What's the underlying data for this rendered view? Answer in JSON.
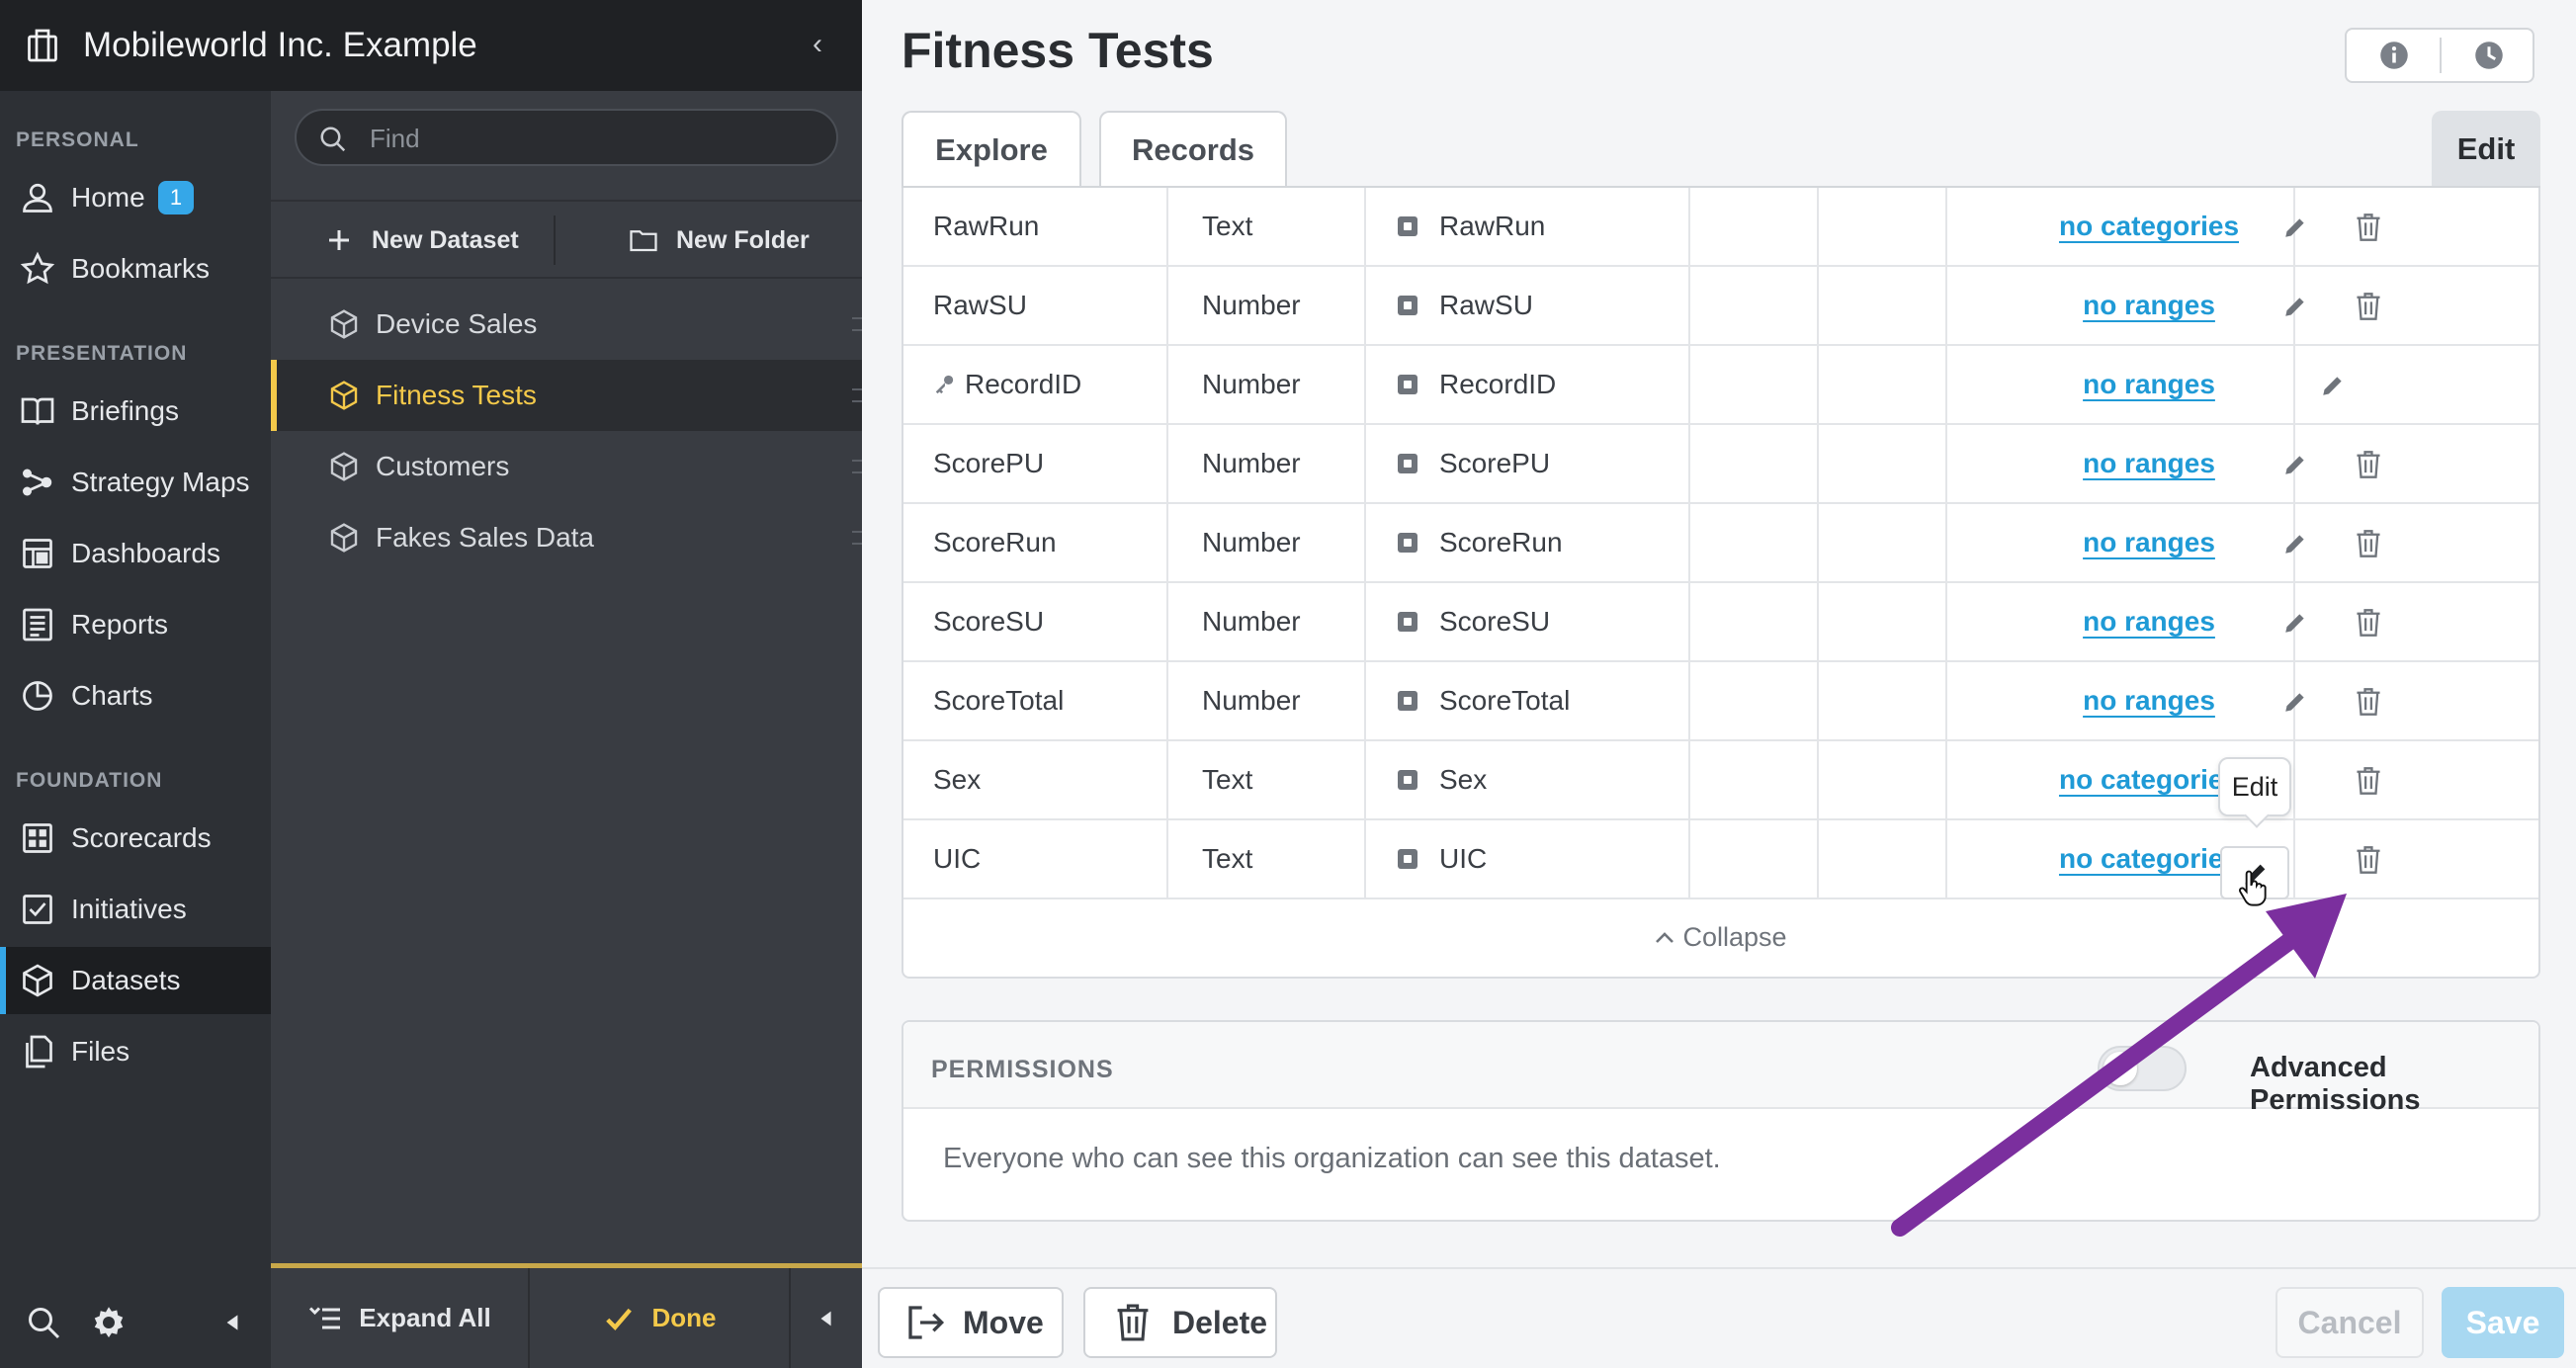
{
  "org": {
    "name": "Mobileworld Inc. Example",
    "icon": "building-icon",
    "collapse_icon": "chevron-left-icon"
  },
  "nav": {
    "sections": {
      "personal": "PERSONAL",
      "presentation": "PRESENTATION",
      "foundation": "FOUNDATION"
    },
    "items": [
      {
        "label": "Home",
        "icon": "person-icon",
        "badge": "1"
      },
      {
        "label": "Bookmarks",
        "icon": "star-icon"
      },
      {
        "label": "Briefings",
        "icon": "book-icon"
      },
      {
        "label": "Strategy Maps",
        "icon": "strategy-map-icon"
      },
      {
        "label": "Dashboards",
        "icon": "dashboard-icon"
      },
      {
        "label": "Reports",
        "icon": "report-icon"
      },
      {
        "label": "Charts",
        "icon": "pie-chart-icon"
      },
      {
        "label": "Scorecards",
        "icon": "scorecard-icon"
      },
      {
        "label": "Initiatives",
        "icon": "checkbox-icon"
      },
      {
        "label": "Datasets",
        "icon": "cube-icon",
        "active": true
      },
      {
        "label": "Files",
        "icon": "files-icon"
      }
    ]
  },
  "tree": {
    "search_placeholder": "Find",
    "new_dataset": "New Dataset",
    "new_folder": "New Folder",
    "datasets": [
      {
        "label": "Device Sales"
      },
      {
        "label": "Fitness Tests",
        "active": true
      },
      {
        "label": "Customers"
      },
      {
        "label": "Fakes Sales Data"
      }
    ],
    "expand_all": "Expand All",
    "done": "Done"
  },
  "main": {
    "title": "Fitness Tests",
    "tabs": {
      "explore": "Explore",
      "records": "Records",
      "edit": "Edit"
    },
    "fields": [
      {
        "name": "RawRun",
        "type": "Text",
        "column": "RawRun",
        "mapping": "no categories",
        "deletable": true
      },
      {
        "name": "RawSU",
        "type": "Number",
        "column": "RawSU",
        "mapping": "no ranges",
        "deletable": true
      },
      {
        "name": "RecordID",
        "type": "Number",
        "column": "RecordID",
        "mapping": "no ranges",
        "key": true,
        "deletable": false
      },
      {
        "name": "ScorePU",
        "type": "Number",
        "column": "ScorePU",
        "mapping": "no ranges",
        "deletable": true
      },
      {
        "name": "ScoreRun",
        "type": "Number",
        "column": "ScoreRun",
        "mapping": "no ranges",
        "deletable": true
      },
      {
        "name": "ScoreSU",
        "type": "Number",
        "column": "ScoreSU",
        "mapping": "no ranges",
        "deletable": true
      },
      {
        "name": "ScoreTotal",
        "type": "Number",
        "column": "ScoreTotal",
        "mapping": "no ranges",
        "deletable": true
      },
      {
        "name": "Sex",
        "type": "Text",
        "column": "Sex",
        "mapping": "no categories",
        "deletable": true
      },
      {
        "name": "UIC",
        "type": "Text",
        "column": "UIC",
        "mapping": "no categories",
        "deletable": true
      }
    ],
    "collapse": "Collapse",
    "tooltip": "Edit",
    "permissions": {
      "title": "PERMISSIONS",
      "advanced_label": "Advanced Permissions",
      "advanced_enabled": false,
      "description": "Everyone who can see this organization can see this dataset."
    },
    "buttons": {
      "move": "Move",
      "delete": "Delete",
      "cancel": "Cancel",
      "save": "Save"
    }
  },
  "colors": {
    "accent": "#35a7e8",
    "active_dataset": "#f4c94a",
    "link": "#1f9ad6",
    "annotation_arrow": "#7b2f9e"
  }
}
